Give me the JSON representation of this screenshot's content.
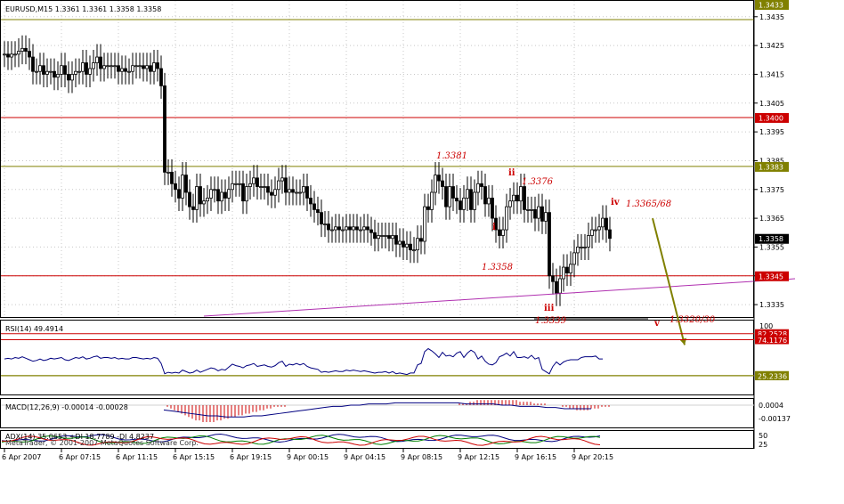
{
  "chart_data": {
    "type": "candlestick",
    "symbol_header": "EURUSD,M15  1.3361 1.3361 1.3358 1.3358",
    "price_axis": {
      "range": [
        1.33307,
        1.34405
      ],
      "ticks": [
        "1.3435",
        "1.3425",
        "1.3415",
        "1.3405",
        "1.3395",
        "1.3385",
        "1.3375",
        "1.3365",
        "1.3355",
        "1.3345",
        "1.3335"
      ],
      "top_label": "1.3433"
    },
    "time_labels": [
      "6 Apr 2007",
      "6 Apr 07:15",
      "6 Apr 11:15",
      "6 Apr 15:15",
      "6 Apr 19:15",
      "9 Apr 00:15",
      "9 Apr 04:15",
      "9 Apr 08:15",
      "9 Apr 12:15",
      "9 Apr 16:15",
      "9 Apr 20:15"
    ],
    "closes": [
      1.3422,
      1.3421,
      1.3422,
      1.3422,
      1.3423,
      1.3424,
      1.3423,
      1.3421,
      1.3416,
      1.3416,
      1.3418,
      1.3415,
      1.3416,
      1.3416,
      1.3414,
      1.3415,
      1.3418,
      1.3415,
      1.3413,
      1.3415,
      1.3416,
      1.3416,
      1.3419,
      1.3415,
      1.3417,
      1.3419,
      1.3421,
      1.3417,
      1.3418,
      1.3418,
      1.3418,
      1.3418,
      1.3416,
      1.3417,
      1.3416,
      1.3416,
      1.3418,
      1.3418,
      1.3418,
      1.3417,
      1.3418,
      1.3416,
      1.3419,
      1.3417,
      1.3411,
      1.3381,
      1.3381,
      1.3377,
      1.3375,
      1.3372,
      1.338,
      1.3374,
      1.3369,
      1.3368,
      1.3376,
      1.337,
      1.3371,
      1.3372,
      1.3375,
      1.3375,
      1.3371,
      1.3374,
      1.3372,
      1.3375,
      1.3377,
      1.3377,
      1.3377,
      1.3371,
      1.3376,
      1.3377,
      1.3379,
      1.3376,
      1.3376,
      1.3376,
      1.3374,
      1.3373,
      1.3375,
      1.3378,
      1.3379,
      1.3374,
      1.3375,
      1.3374,
      1.3374,
      1.3374,
      1.3376,
      1.3372,
      1.337,
      1.3368,
      1.3367,
      1.3363,
      1.3363,
      1.3361,
      1.3361,
      1.3362,
      1.3361,
      1.3361,
      1.3362,
      1.3361,
      1.3362,
      1.3361,
      1.3361,
      1.3362,
      1.3361,
      1.336,
      1.3358,
      1.3359,
      1.3359,
      1.3359,
      1.3358,
      1.3359,
      1.3356,
      1.3357,
      1.3355,
      1.3356,
      1.3354,
      1.3354,
      1.3358,
      1.3357,
      1.3369,
      1.3368,
      1.3374,
      1.338,
      1.3378,
      1.3376,
      1.3369,
      1.3376,
      1.3372,
      1.3371,
      1.3368,
      1.3372,
      1.3375,
      1.3368,
      1.3374,
      1.3377,
      1.3376,
      1.337,
      1.3372,
      1.3365,
      1.3361,
      1.3359,
      1.3361,
      1.3369,
      1.3371,
      1.3373,
      1.3371,
      1.3376,
      1.3368,
      1.3368,
      1.3368,
      1.3365,
      1.3369,
      1.3364,
      1.3367,
      1.3345,
      1.3343,
      1.3339,
      1.3344,
      1.3348,
      1.3346,
      1.3349,
      1.3353,
      1.3355,
      1.3355,
      1.3355,
      1.3359,
      1.3361,
      1.3361,
      1.3362,
      1.3365,
      1.3361,
      1.3358
    ],
    "horizontal_levels": [
      {
        "value": 1.3434,
        "label": "1.3433",
        "color": "#808000"
      },
      {
        "value": 1.34,
        "label": "1.3400",
        "color": "#cc0000"
      },
      {
        "value": 1.3383,
        "label": "1.3383",
        "color": "#808000"
      },
      {
        "value": 1.3358,
        "label": "1.3358",
        "color": "#333333"
      },
      {
        "value": 1.3345,
        "label": "1.3345",
        "color": "#cc0000"
      }
    ],
    "trendline": {
      "from": {
        "bar": 56,
        "price": 1.3331
      },
      "to": {
        "bar": 222,
        "price": 1.3344
      },
      "color": "#b030b0"
    },
    "projection": {
      "from": {
        "bar": 182,
        "price": 1.3365
      },
      "to": {
        "bar": 191,
        "price": 1.3321
      },
      "color": "#808000"
    },
    "waves": [
      {
        "label": "i",
        "value": "1.3358",
        "kind": "low"
      },
      {
        "label": "ii",
        "value": "1.3376",
        "kind": "high"
      },
      {
        "label": "iii",
        "value": "1.3339",
        "kind": "low"
      },
      {
        "label": "iv",
        "value": "1.3365/68",
        "kind": "high"
      },
      {
        "label": "v",
        "value": "1.3320/30",
        "kind": "target"
      }
    ],
    "extra_value_labels": [
      "1.3381"
    ],
    "rsi": {
      "title": "RSI(14) 49.4914",
      "axis_top": "100",
      "levels": [
        "82.2528",
        "74.1176",
        "25.5882",
        "25.2336"
      ],
      "values": [
        48,
        49,
        48,
        50,
        49,
        51,
        49,
        47,
        45,
        46,
        48,
        46,
        47,
        49,
        48,
        49,
        50,
        47,
        46,
        48,
        50,
        49,
        51,
        48,
        49,
        51,
        52,
        49,
        50,
        50,
        49,
        50,
        48,
        49,
        48,
        48,
        50,
        50,
        49,
        48,
        49,
        48,
        50,
        49,
        42,
        28,
        30,
        29,
        30,
        29,
        33,
        31,
        29,
        30,
        33,
        30,
        32,
        34,
        36,
        35,
        32,
        34,
        33,
        37,
        41,
        39,
        38,
        36,
        39,
        40,
        42,
        38,
        39,
        40,
        38,
        37,
        39,
        43,
        45,
        38,
        41,
        40,
        42,
        40,
        42,
        38,
        36,
        35,
        34,
        30,
        31,
        30,
        31,
        32,
        31,
        31,
        33,
        32,
        33,
        32,
        31,
        32,
        31,
        30,
        29,
        30,
        30,
        31,
        29,
        31,
        28,
        29,
        28,
        27,
        29,
        29,
        40,
        42,
        58,
        62,
        59,
        55,
        50,
        57,
        52,
        53,
        51,
        56,
        58,
        50,
        56,
        60,
        57,
        48,
        52,
        45,
        41,
        40,
        43,
        51,
        53,
        56,
        52,
        58,
        50,
        50,
        51,
        49,
        53,
        48,
        50,
        34,
        31,
        28,
        38,
        44,
        40,
        44,
        46,
        47,
        47,
        47,
        50,
        51,
        51,
        51,
        52,
        48,
        48
      ]
    },
    "macd": {
      "title": "MACD(12,26,9) -0.00014 -0.00028",
      "ticks": [
        "0.0004",
        "-0.00137"
      ],
      "histogram": [
        0,
        -1,
        -2,
        -3,
        -4,
        -5,
        -6,
        -7,
        -8,
        -9,
        -9,
        -10,
        -10,
        -10,
        -10,
        -9,
        -9,
        -8,
        -8,
        -7,
        -7,
        -6,
        -6,
        -5,
        -5,
        -4,
        -4,
        -3,
        -3,
        -2,
        -2,
        -1,
        -1,
        -1,
        -1,
        0,
        0,
        0,
        0,
        0,
        0,
        0,
        0,
        0,
        0,
        0,
        0,
        0,
        0,
        0,
        0,
        0,
        0,
        0,
        0,
        0,
        0,
        0,
        0,
        0,
        0,
        0,
        0,
        0,
        0,
        0,
        0,
        0,
        0,
        0,
        0,
        0,
        0,
        0,
        0,
        0,
        0,
        0,
        0,
        0,
        0,
        0,
        0,
        1,
        1,
        1,
        2,
        2,
        3,
        3,
        3,
        3,
        3,
        3,
        3,
        3,
        3,
        3,
        3,
        3,
        2,
        2,
        2,
        2,
        1,
        1,
        1,
        1,
        0,
        0,
        0,
        0,
        -1,
        -1,
        -2,
        -2,
        -3,
        -3,
        -3,
        -3,
        -2,
        -2,
        -2,
        -1,
        -1,
        -1
      ],
      "signal": [
        -4,
        -5,
        -6,
        -7,
        -8,
        -9,
        -9,
        -10,
        -10,
        -10,
        -9,
        -9,
        -8,
        -7,
        -6,
        -5,
        -4,
        -3,
        -2,
        -1,
        -1,
        0,
        0,
        1,
        1,
        1,
        2,
        2,
        2,
        2,
        2,
        2,
        2,
        2,
        1,
        1,
        1,
        1,
        0,
        0,
        -1,
        -1,
        -1,
        -2,
        -2,
        -3,
        -3,
        -3,
        -3
      ]
    },
    "adx": {
      "title": "ADX(14) 35.0653 +DI 18.7789 -DI 4.8237",
      "ticks": [
        "50",
        "25"
      ],
      "copyright": "MetaTrader, © 2001-2007 MetaQuotes Software Corp."
    }
  }
}
